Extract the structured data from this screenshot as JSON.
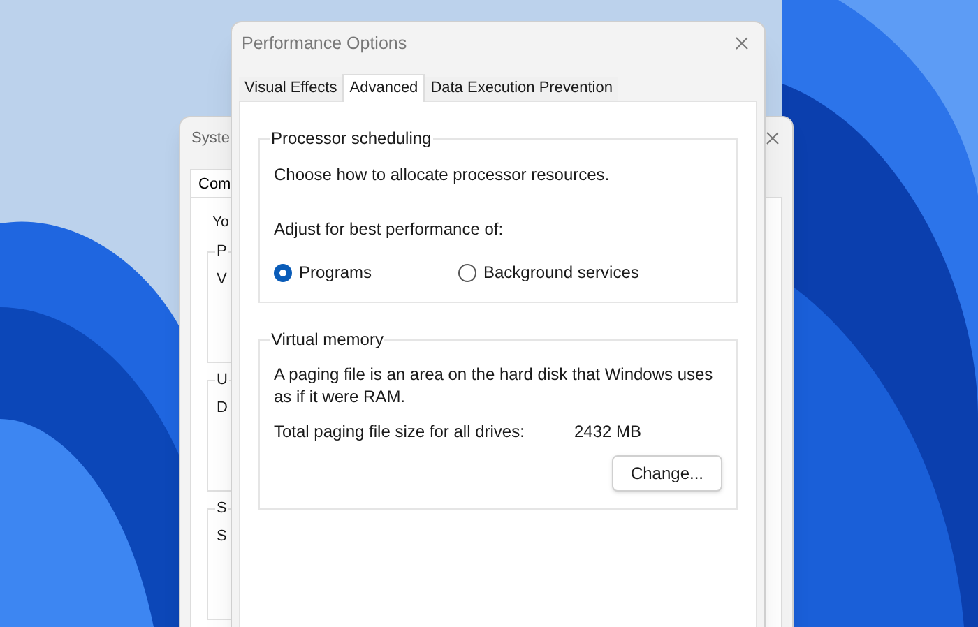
{
  "background_window": {
    "title": "Syste",
    "tabs": [
      {
        "label": "Com",
        "selected": true
      }
    ],
    "intro": "Yo",
    "groups": [
      {
        "legend": "P",
        "text": "V"
      },
      {
        "legend": "U",
        "text": "D"
      },
      {
        "legend": "S",
        "text": "S"
      }
    ]
  },
  "window": {
    "title": "Performance Options"
  },
  "tabs": [
    {
      "label": "Visual Effects",
      "selected": false
    },
    {
      "label": "Advanced",
      "selected": true
    },
    {
      "label": "Data Execution Prevention",
      "selected": false
    }
  ],
  "processor_scheduling": {
    "legend": "Processor scheduling",
    "description": "Choose how to allocate processor resources.",
    "prompt": "Adjust for best performance of:",
    "options": [
      {
        "label": "Programs",
        "selected": true
      },
      {
        "label": "Background services",
        "selected": false
      }
    ]
  },
  "virtual_memory": {
    "legend": "Virtual memory",
    "description": "A paging file is an area on the hard disk that Windows uses as if it were RAM.",
    "total_label": "Total paging file size for all drives:",
    "total_value": "2432 MB",
    "button": "Change..."
  }
}
